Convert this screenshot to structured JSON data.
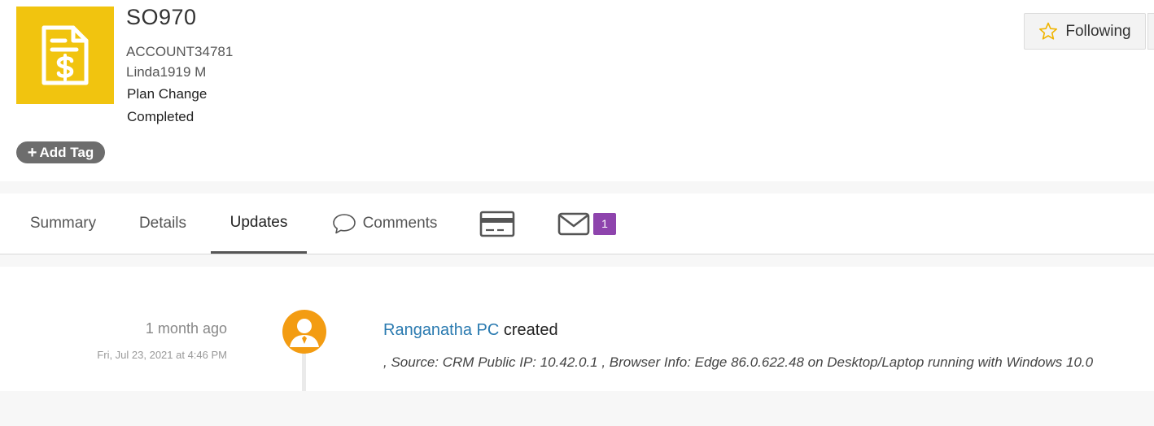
{
  "record": {
    "title": "SO970",
    "account": "ACCOUNT34781",
    "contact": "Linda1919 M",
    "type": "Plan Change",
    "status": "Completed",
    "icon": "invoice-dollar-icon",
    "icon_color": "#f1c40f"
  },
  "actions": {
    "add_tag_label": "Add Tag",
    "following_label": "Following"
  },
  "tabs": [
    {
      "label": "Summary"
    },
    {
      "label": "Details"
    },
    {
      "label": "Updates",
      "active": true
    },
    {
      "label": "Comments"
    },
    {
      "icon": "card-icon"
    },
    {
      "icon": "mail-icon",
      "badge": "1"
    }
  ],
  "timeline": [
    {
      "time_ago": "1 month ago",
      "date": "Fri, Jul 23, 2021 at 4:46 PM",
      "user": "Ranganatha PC",
      "action": "created",
      "detail": ", Source: CRM Public IP: 10.42.0.1 , Browser Info: Edge 86.0.622.48 on Desktop/Laptop running with Windows 10.0"
    }
  ],
  "colors": {
    "accent_link": "#2a7ab0",
    "badge": "#8e44ad",
    "avatar": "#f39c12"
  }
}
